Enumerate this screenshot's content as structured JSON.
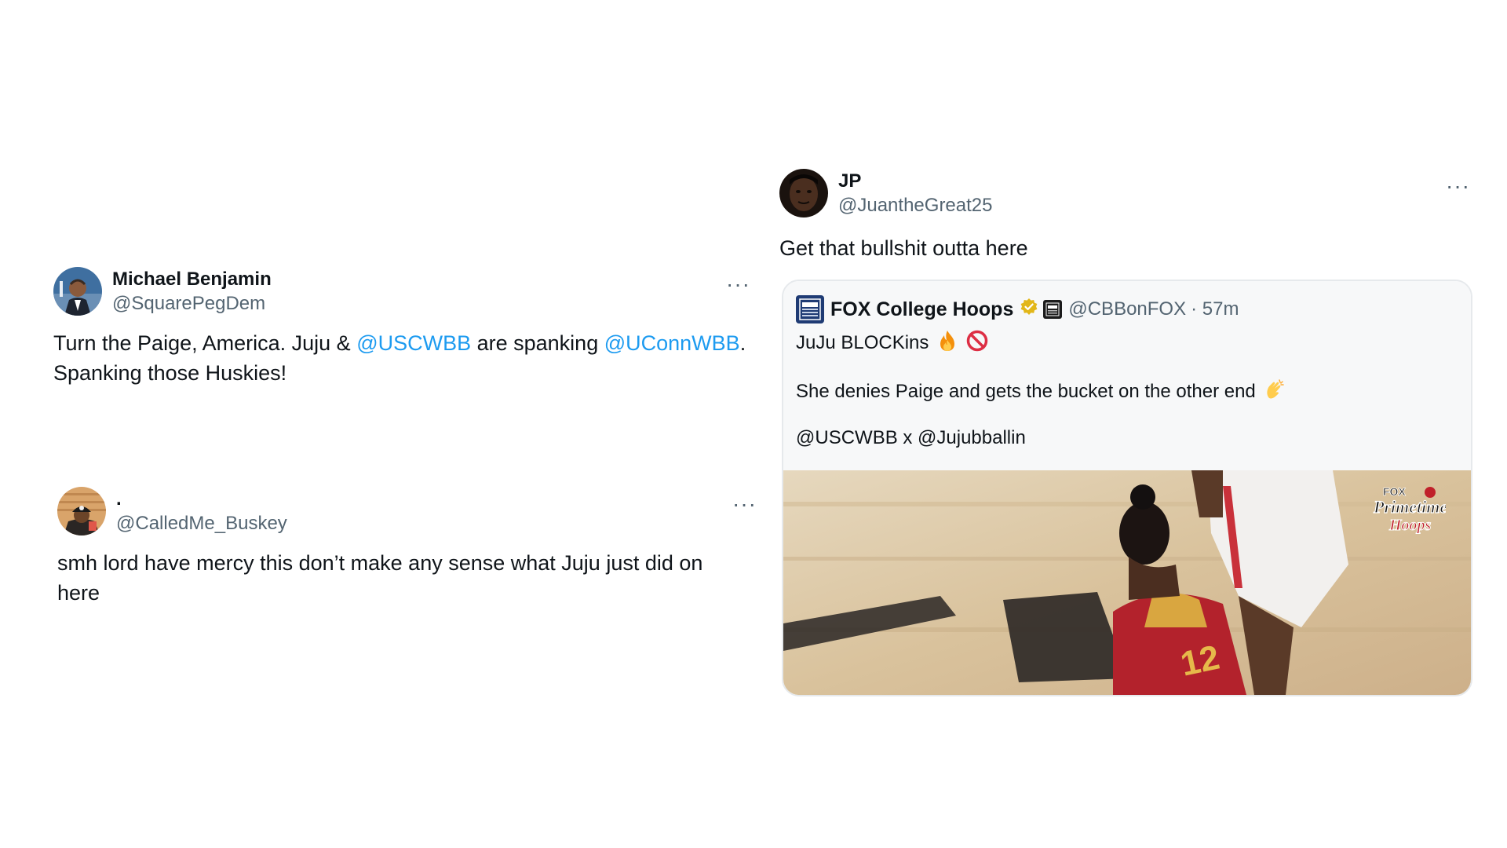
{
  "tweets": [
    {
      "id": "michael",
      "name": "Michael Benjamin",
      "handle": "@SquarePegDem",
      "more": "···",
      "text_parts": [
        {
          "t": "Turn the Paige, America. Juju & ",
          "mention": false
        },
        {
          "t": "@USCWBB",
          "mention": true
        },
        {
          "t": " are spanking ",
          "mention": false
        },
        {
          "t": "@UConnWBB",
          "mention": true
        },
        {
          "t": ". Spanking those Huskies!",
          "mention": false
        }
      ]
    },
    {
      "id": "buskey",
      "name": ".",
      "handle": "@CalledMe_Buskey",
      "more": "···",
      "text": "smh lord have mercy this don’t make any sense what Juju just did on here"
    },
    {
      "id": "jp",
      "name": "JP",
      "handle": "@JuantheGreat25",
      "more": "···",
      "text": "Get that bullshit outta here"
    }
  ],
  "quote": {
    "name": "FOX College Hoops",
    "handle": "@CBBonFOX",
    "time": "· 57m",
    "line1": "JuJu BLOCKins",
    "line2": "She denies Paige and gets the bucket on the other end",
    "line3": "@USCWBB x @Jujubballin",
    "media_jersey_number": "12",
    "watermark": [
      "FOX",
      "Primetime",
      "Hoops"
    ]
  },
  "colors": {
    "mention": "#1d9bf0",
    "secondary_text": "#536471",
    "quote_bg": "#f7f8f9",
    "verified_gold": "#e2b719"
  },
  "icons": {
    "verified": "verified-gold-badge-icon",
    "fire": "fire-emoji-icon",
    "prohibited": "prohibited-emoji-icon",
    "clap": "clapping-hands-emoji-icon"
  }
}
